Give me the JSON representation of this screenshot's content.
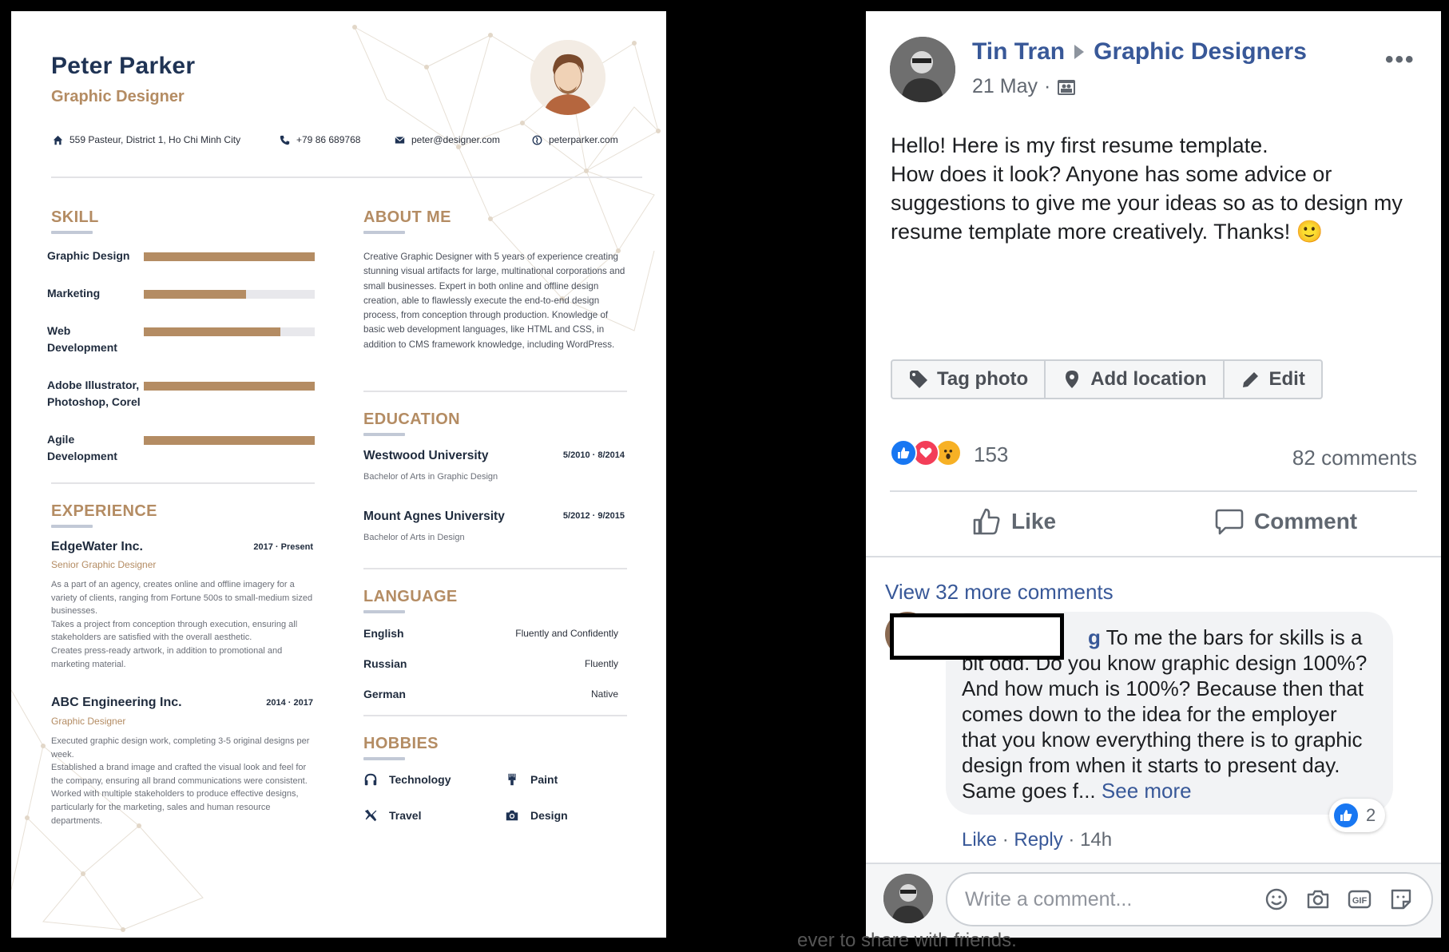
{
  "resume": {
    "name": "Peter Parker",
    "title": "Graphic Designer",
    "contact": {
      "address": "559 Pasteur, District 1, Ho Chi Minh City",
      "phone": "+79 86 689768",
      "email": "peter@designer.com",
      "website": "peterparker.com"
    },
    "skill": {
      "title": "SKILL",
      "items": [
        {
          "label": "Graphic Design",
          "level": 1.0
        },
        {
          "label": "Marketing",
          "level": 0.6
        },
        {
          "label": "Web\nDevelopment",
          "level": 0.8
        },
        {
          "label": "Adobe Illustrator,\nPhotoshop, Corel",
          "level": 1.0
        },
        {
          "label": "Agile\nDevelopment",
          "level": 1.0
        }
      ]
    },
    "experience": {
      "title": "EXPERIENCE",
      "jobs": [
        {
          "company": "EdgeWater Inc.",
          "dates": "2017  ·  Present",
          "role": "Senior Graphic Designer",
          "desc": "As a part of an agency, creates online and offline imagery for a variety of clients, ranging from Fortune 500s to small-medium sized businesses.\nTakes a project from conception through execution, ensuring all stakeholders are satisfied with the overall aesthetic.\nCreates press-ready artwork, in addition to promotional and marketing material."
        },
        {
          "company": "ABC Engineering Inc.",
          "dates": "2014  ·  2017",
          "role": "Graphic Designer",
          "desc": "Executed graphic design work, completing 3-5 original designs per week.\nEstablished a brand image and crafted the visual look and feel for the company, ensuring all brand communications were consistent.\nWorked with multiple stakeholders to produce effective designs, particularly for the marketing, sales and human resource departments."
        }
      ]
    },
    "about": {
      "title": "ABOUT ME",
      "text": "Creative Graphic Designer with 5 years of experience creating stunning visual artifacts for large, multinational corporations and small businesses. Expert in both online and offline design creation, able to flawlessly execute the end-to-end design process, from conception through production. Knowledge of basic web development languages, like HTML and CSS, in addition to CMS framework knowledge, including WordPress."
    },
    "education": {
      "title": "EDUCATION",
      "items": [
        {
          "school": "Westwood University",
          "dates": "5/2010  ·  8/2014",
          "degree": "Bachelor of Arts in Graphic Design"
        },
        {
          "school": "Mount Agnes University",
          "dates": "5/2012  ·  9/2015",
          "degree": "Bachelor of Arts in Design"
        }
      ]
    },
    "language": {
      "title": "LANGUAGE",
      "items": [
        {
          "name": "English",
          "level": "Fluently and Confidently"
        },
        {
          "name": "Russian",
          "level": "Fluently"
        },
        {
          "name": "German",
          "level": "Native"
        }
      ]
    },
    "hobbies": {
      "title": "HOBBIES",
      "items": [
        "Technology",
        "Paint",
        "Travel",
        "Design"
      ]
    },
    "colors": {
      "accent": "#b48c63",
      "navy": "#1f3354"
    }
  },
  "post": {
    "author": "Tin Tran",
    "group": "Graphic Designers",
    "date": "21 May",
    "dot": "·",
    "more": "•••",
    "text_lines": [
      "Hello! Here is my first resume template.",
      "How does it look? Anyone has some advice or suggestions to give me your ideas so as to design my resume template more creatively. Thanks! 🙂"
    ],
    "tag_actions": [
      "Tag photo",
      "Add location",
      "Edit"
    ],
    "reactions_count": "153",
    "comments_count": "82 comments",
    "actions": {
      "like": "Like",
      "comment": "Comment"
    },
    "view_more": "View 32 more comments",
    "comment": {
      "name_tail": "g",
      "text": " To me the bars for skills is a bit odd. Do you know graphic design 100%? And how much is 100%? Because then that comes down to the idea for the employer that you know everything there is to graphic design from when it starts to present day. Same goes f...",
      "see_more": "See more",
      "likes": "2",
      "like": "Like",
      "reply": "Reply",
      "sep": "·",
      "time": "14h"
    },
    "write_placeholder": "Write a comment...",
    "colors": {
      "link": "#385898",
      "like_blue": "#1877f2",
      "love_red": "#f33e58",
      "wow_yellow": "#f7b125"
    }
  },
  "background_text": "ever to share with friends."
}
